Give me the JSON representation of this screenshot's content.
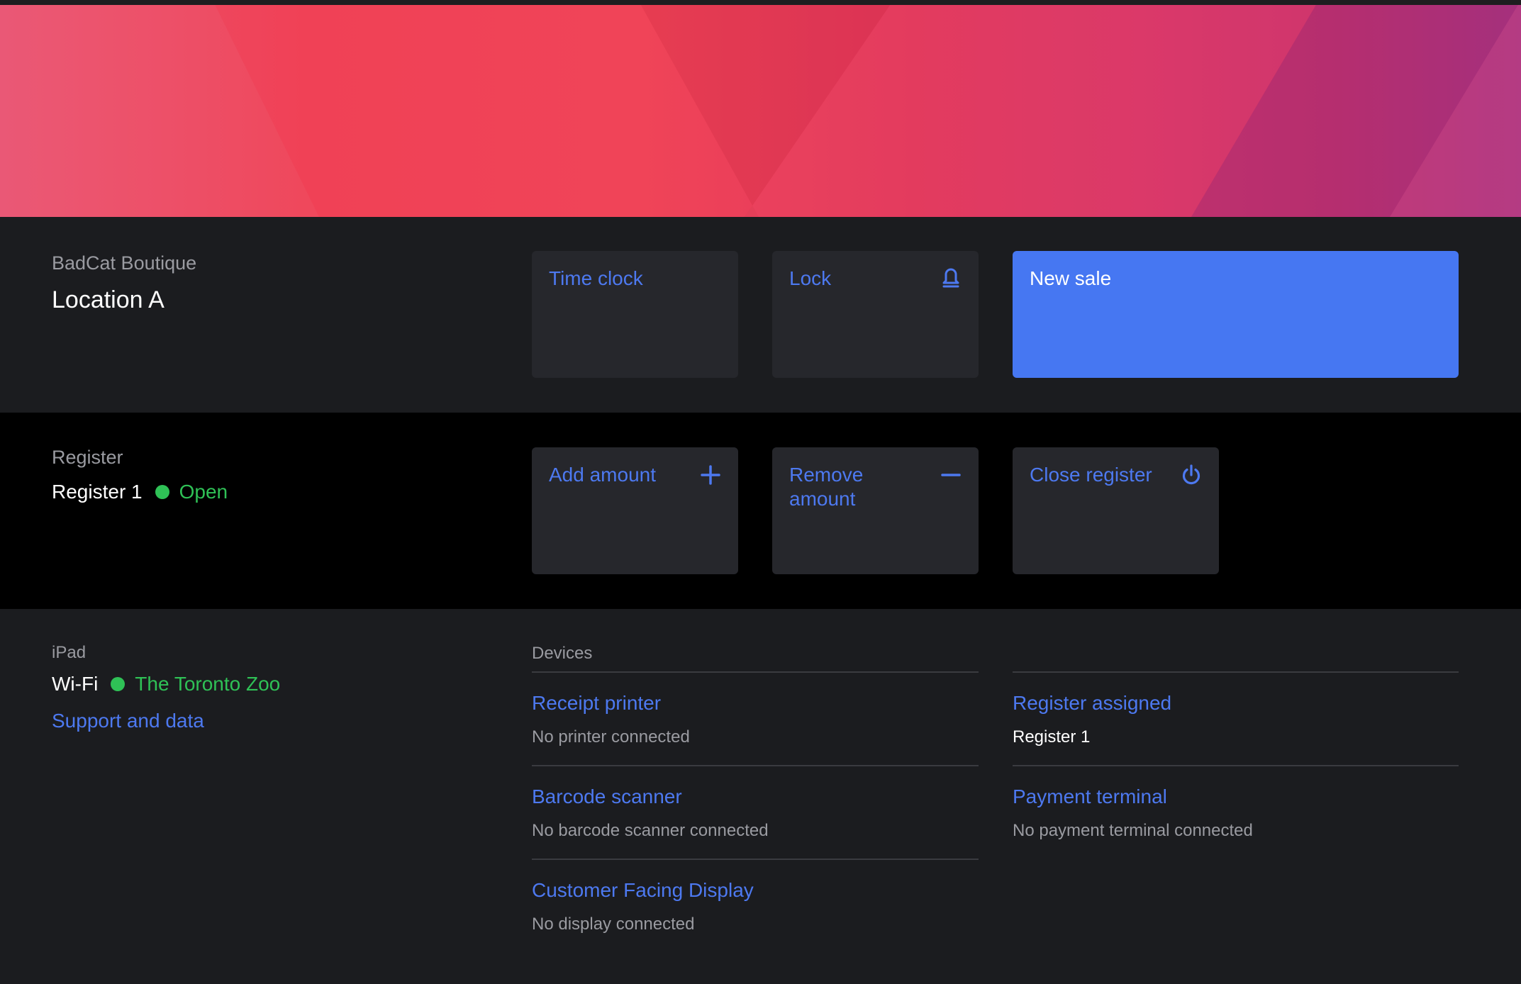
{
  "store": {
    "name": "BadCat Boutique",
    "location": "Location A"
  },
  "top_actions": {
    "time_clock": "Time clock",
    "lock": "Lock",
    "new_sale": "New sale"
  },
  "register": {
    "eyebrow": "Register",
    "name": "Register 1",
    "status": "Open",
    "status_color": "#2fc156",
    "actions": {
      "add_amount": "Add amount",
      "remove_amount": "Remove amount",
      "close_register": "Close register"
    }
  },
  "ipad": {
    "eyebrow": "iPad",
    "wifi_label": "Wi-Fi",
    "wifi_network": "The Toronto Zoo",
    "support_link": "Support and data"
  },
  "devices": {
    "heading": "Devices",
    "receipt_printer": {
      "name": "Receipt printer",
      "status": "No printer connected"
    },
    "barcode_scanner": {
      "name": "Barcode scanner",
      "status": "No barcode scanner connected"
    },
    "customer_display": {
      "name": "Customer Facing Display",
      "status": "No display connected"
    },
    "register_assigned": {
      "name": "Register assigned",
      "status": "Register 1"
    },
    "payment_terminal": {
      "name": "Payment terminal",
      "status": "No payment terminal connected"
    }
  },
  "colors": {
    "accent": "#4d79f0",
    "primary_button": "#4677f2",
    "status_green": "#2fc156"
  }
}
